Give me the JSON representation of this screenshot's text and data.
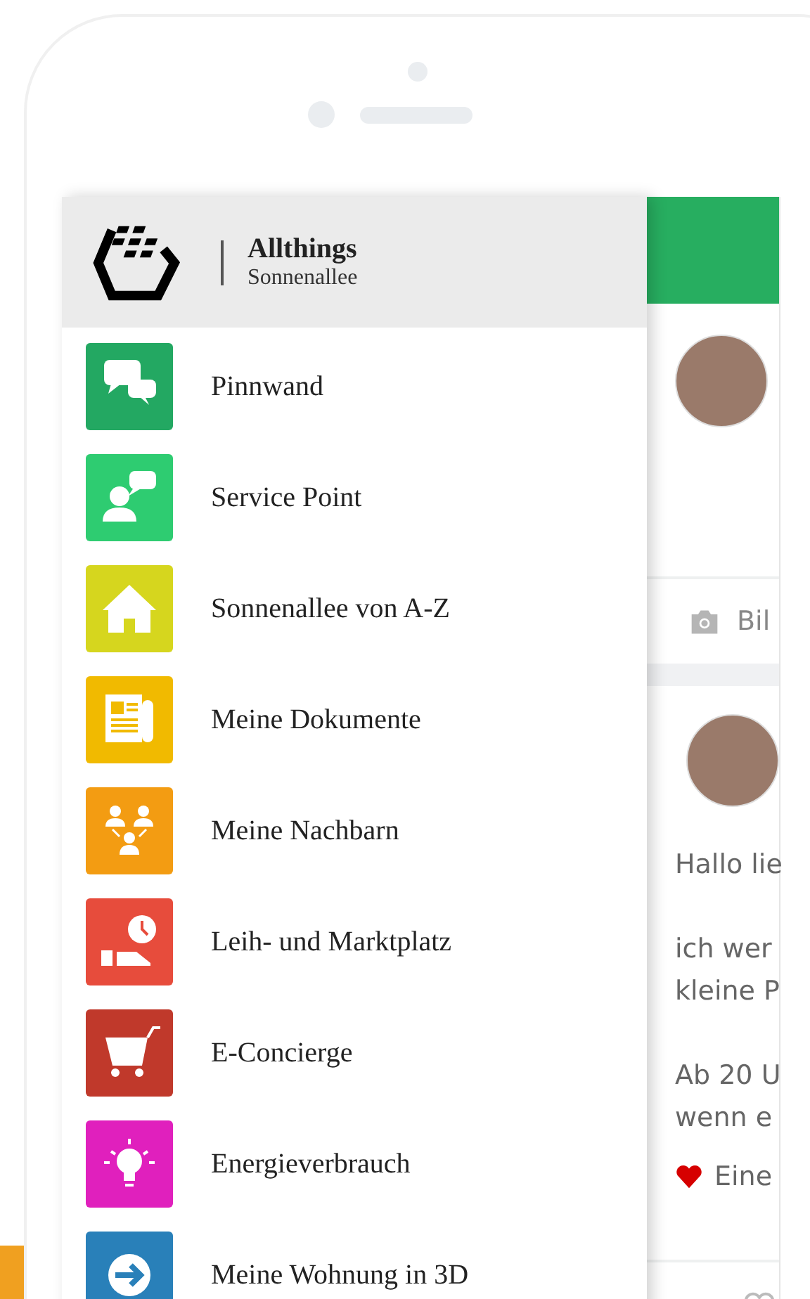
{
  "header": {
    "title": "Allthings",
    "subtitle": "Sonnenallee"
  },
  "menu": [
    {
      "label": "Pinnwand",
      "kind": "chat",
      "color": "#23a862"
    },
    {
      "label": "Service Point",
      "kind": "support",
      "color": "#2ecc71"
    },
    {
      "label": "Sonnenallee von A-Z",
      "kind": "house",
      "color": "#d6d61e"
    },
    {
      "label": "Meine Dokumente",
      "kind": "newspaper",
      "color": "#f1ba00"
    },
    {
      "label": "Meine Nachbarn",
      "kind": "people",
      "color": "#f39c12"
    },
    {
      "label": "Leih- und Marktplatz",
      "kind": "lend",
      "color": "#e74c3c"
    },
    {
      "label": "E-Concierge",
      "kind": "cart",
      "color": "#c0392b"
    },
    {
      "label": "Energieverbrauch",
      "kind": "bulb",
      "color": "#e020bd"
    },
    {
      "label": "Meine Wohnung in 3D",
      "kind": "arrow",
      "color": "#2980b9"
    }
  ],
  "feed": {
    "photo_action": "Bil",
    "post_paragraphs": [
      [
        "Hallo lie"
      ],
      [
        "ich wer",
        "kleine P"
      ],
      [
        "Ab 20 U",
        "wenn e"
      ]
    ],
    "like_text": "Eine"
  }
}
